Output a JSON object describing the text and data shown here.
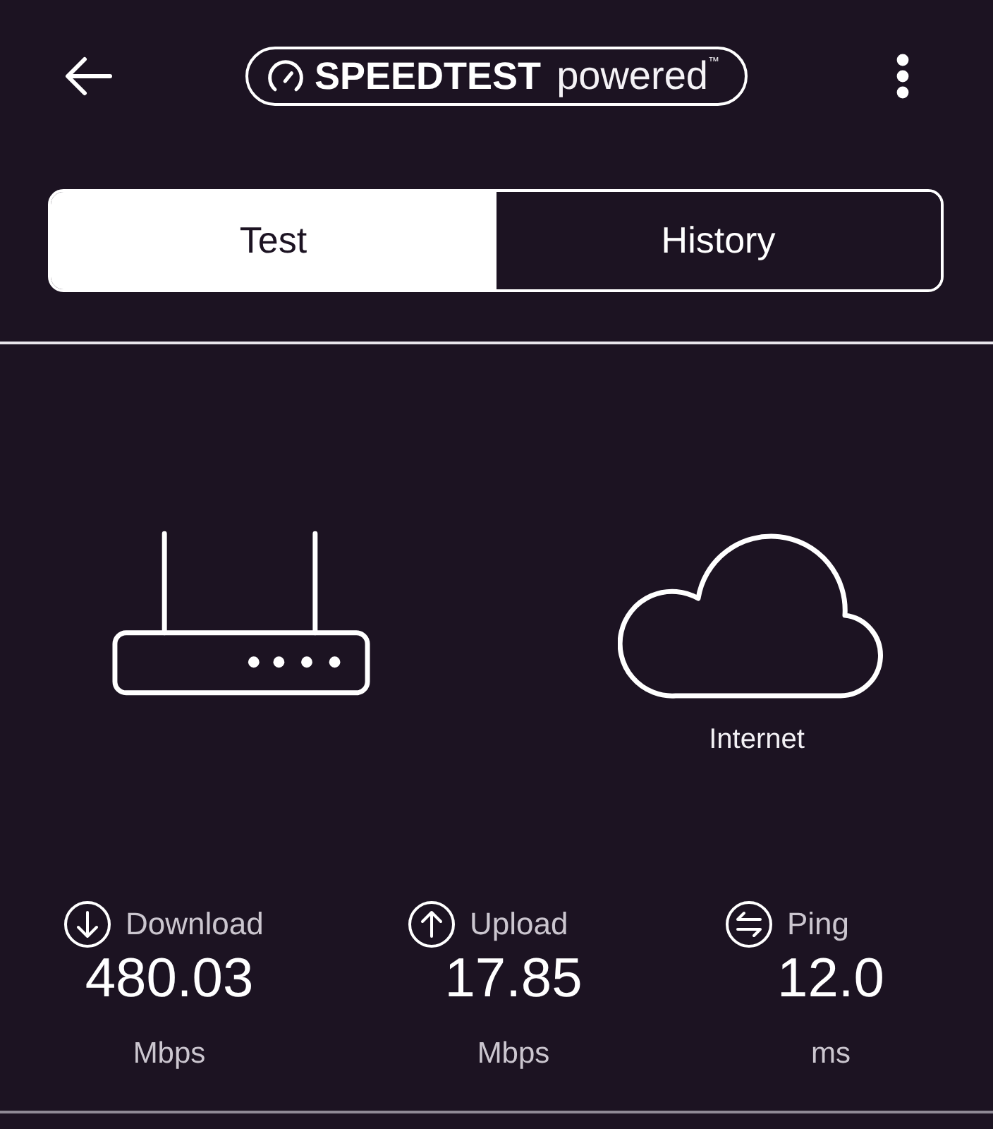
{
  "top_bar": {
    "logo": {
      "brand": "SPEEDTEST",
      "suffix": "powered$^{™}$"
    }
  },
  "tabs": [
    {
      "label": "Test",
      "selected": true
    },
    {
      "label": "History",
      "selected": false
    }
  ],
  "connection": {
    "destination_label": "Internet"
  },
  "results": [
    {
      "kind": "download",
      "label": "Download",
      "value": "480.03",
      "unit": "Mbps"
    },
    {
      "kind": "upload",
      "label": "Upload",
      "value": "17.85",
      "unit": "Mbps"
    },
    {
      "kind": "ping",
      "label": "Ping",
      "value": "12.0",
      "unit": "ms"
    }
  ]
}
